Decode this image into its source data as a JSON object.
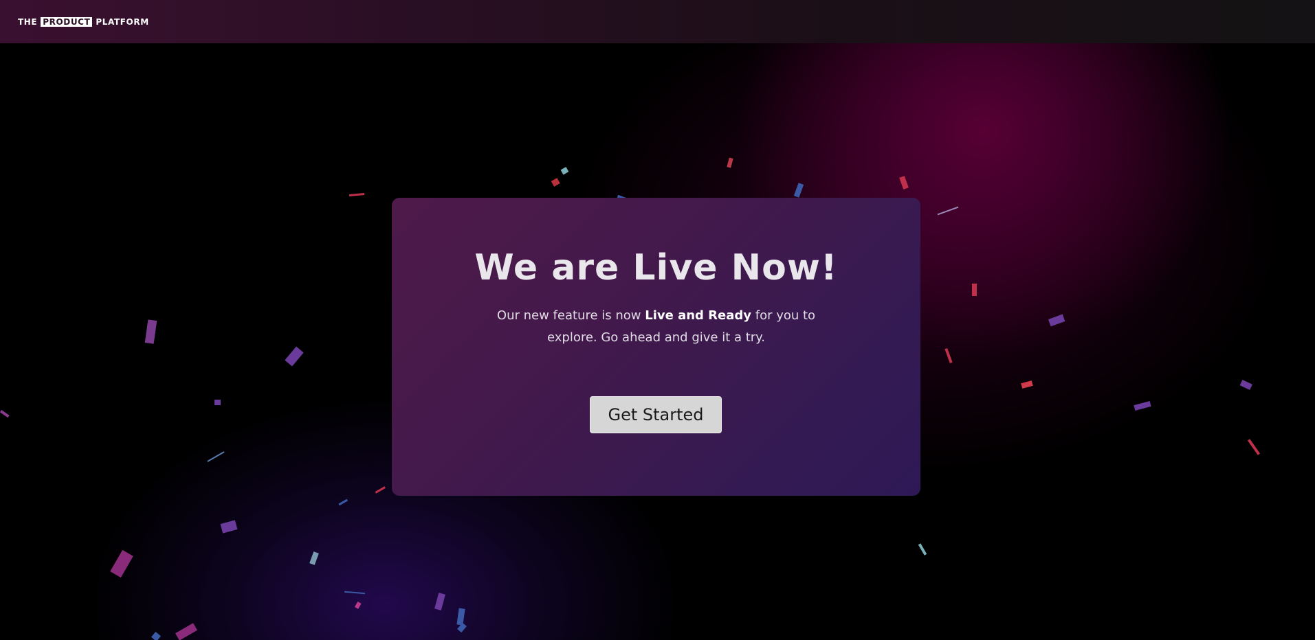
{
  "header": {
    "logo_prefix": "THE",
    "logo_boxed": "PRODUCT",
    "logo_suffix": "PLATFORM"
  },
  "hero": {
    "title": "We are Live Now!",
    "desc_before": "Our new feature is now ",
    "desc_bold": "Live and Ready",
    "desc_after": " for you to explore. Go ahead and give it a try.",
    "cta_label": "Get Started"
  },
  "colors": {
    "topbar": "#2a0f24",
    "card_start": "#4e1a4a",
    "card_end": "#2e1956",
    "button_bg": "#d6d6d6",
    "confetti": [
      "#b83a6a",
      "#6a3b9a",
      "#d13a4a",
      "#3a5aa8",
      "#7ab0b8"
    ]
  }
}
